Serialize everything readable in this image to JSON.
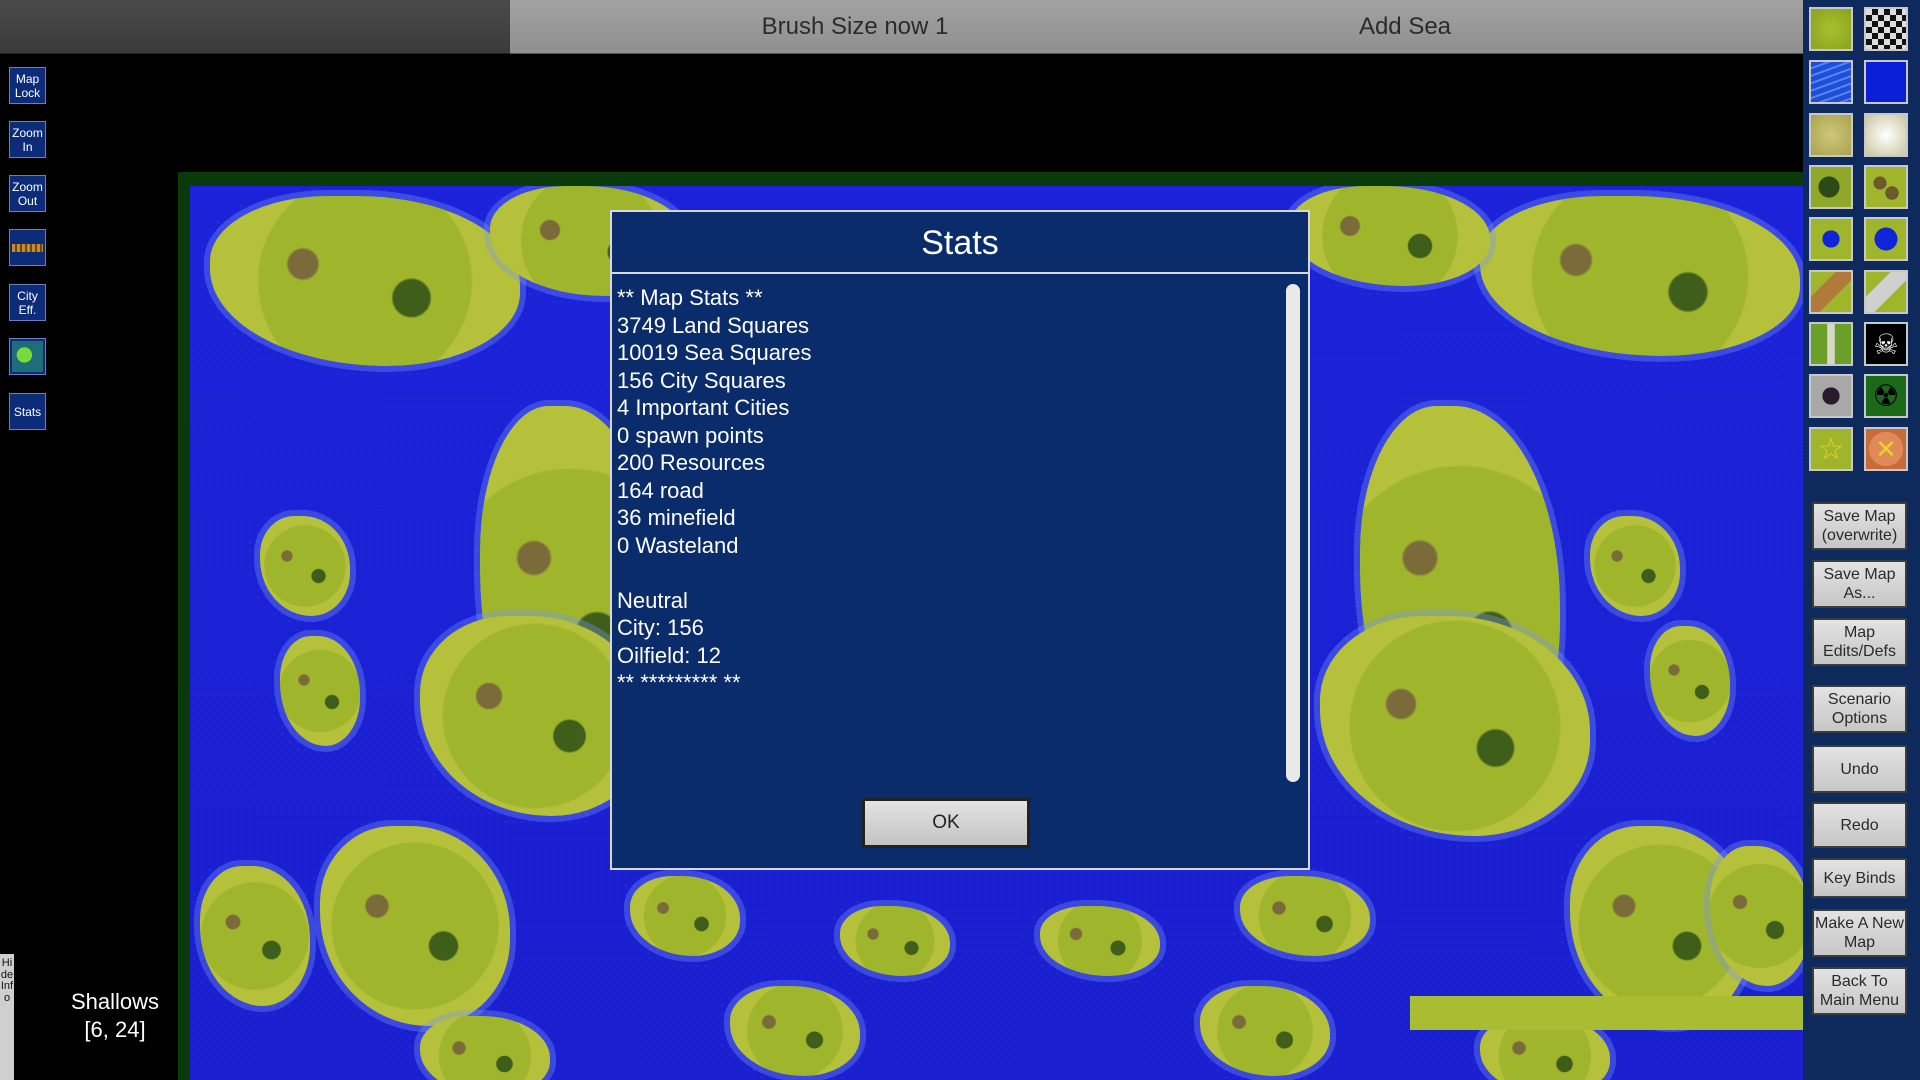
{
  "topbar": {
    "brush_label": "Brush Size now 1",
    "mode_label": "Add Sea"
  },
  "left_toolbar": {
    "map_lock": "Map Lock",
    "zoom_in": "Zoom In",
    "zoom_out": "Zoom Out",
    "city_eff": "City Eff.",
    "stats": "Stats",
    "hide_info": "Hide Info"
  },
  "tile_info": {
    "terrain": "Shallows",
    "coords": "[6, 24]"
  },
  "dialog": {
    "title": "Stats",
    "lines": [
      "** Map Stats **",
      "3749 Land Squares",
      "10019 Sea Squares",
      "156 City Squares",
      "4 Important Cities",
      "0 spawn points",
      "200 Resources",
      "164 road",
      "36 minefield",
      "0 Wasteland",
      "",
      "Neutral",
      "City: 156",
      "Oilfield: 12",
      "** ********* **"
    ],
    "ok_label": "OK"
  },
  "right_panel": {
    "save_overwrite": "Save Map (overwrite)",
    "save_as": "Save Map As...",
    "map_edits": "Map Edits/Defs",
    "scenario": "Scenario Options",
    "undo": "Undo",
    "redo": "Redo",
    "key_binds": "Key Binds",
    "new_map": "Make A New Map",
    "main_menu": "Back To Main Menu"
  },
  "colors": {
    "sea": "#1c22d9",
    "land": "#9fb52c",
    "dialog_bg": "#0a2c6b",
    "panel_bg": "#0e2a5c"
  }
}
